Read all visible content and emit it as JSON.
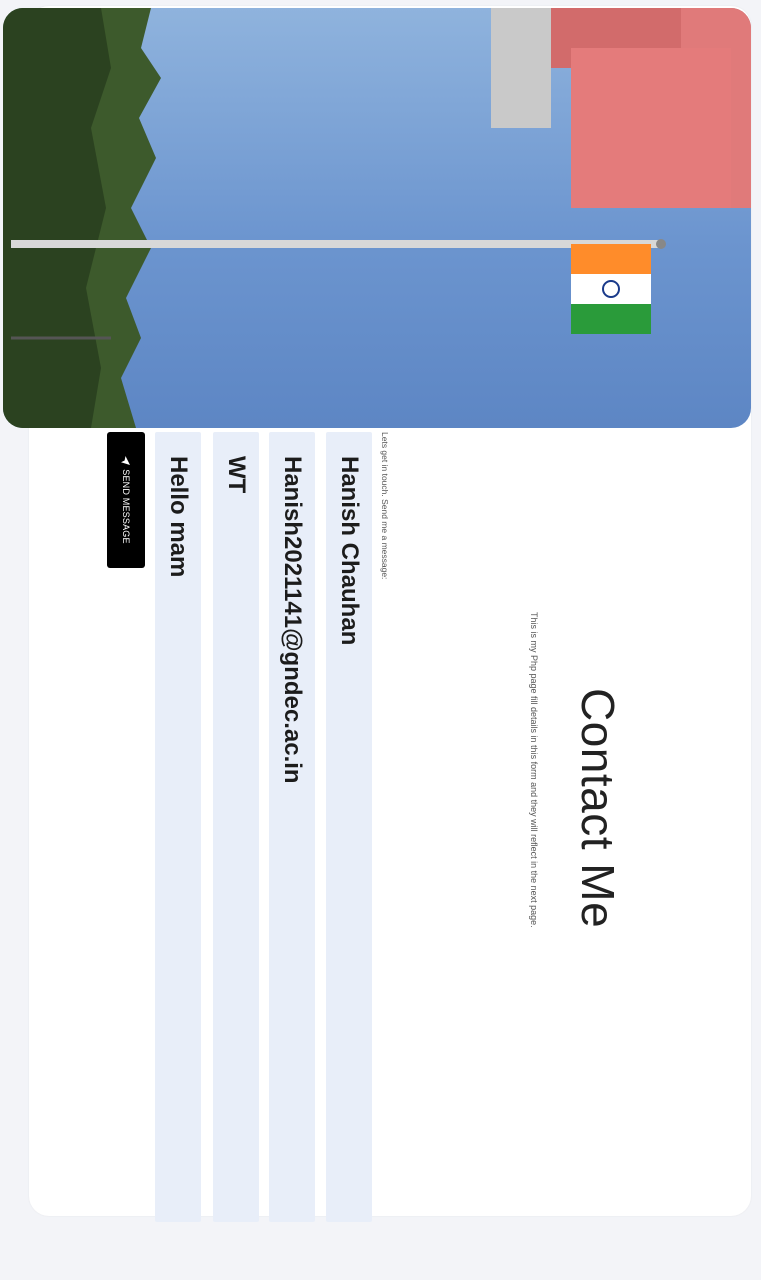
{
  "contact": {
    "title": "Contact Me",
    "subtitle": "This is my Php page fill details in this form and they will reflect in the next page.",
    "hint": "Lets get in touch. Send me a message:"
  },
  "form": {
    "name_value": "Hanish Chauhan",
    "email_value": "Hanish2021141@gndec.ac.in",
    "subject_value": "WT",
    "message_value": "Hello mam",
    "send_label": "SEND MESSAGE",
    "send_icon": "send-icon"
  },
  "photo": {
    "subject": "flag-pole-photo",
    "flag_colors": [
      "#ff8c2a",
      "#ffffff",
      "#2a9b3a"
    ],
    "sky_color": "#6c95cf"
  }
}
